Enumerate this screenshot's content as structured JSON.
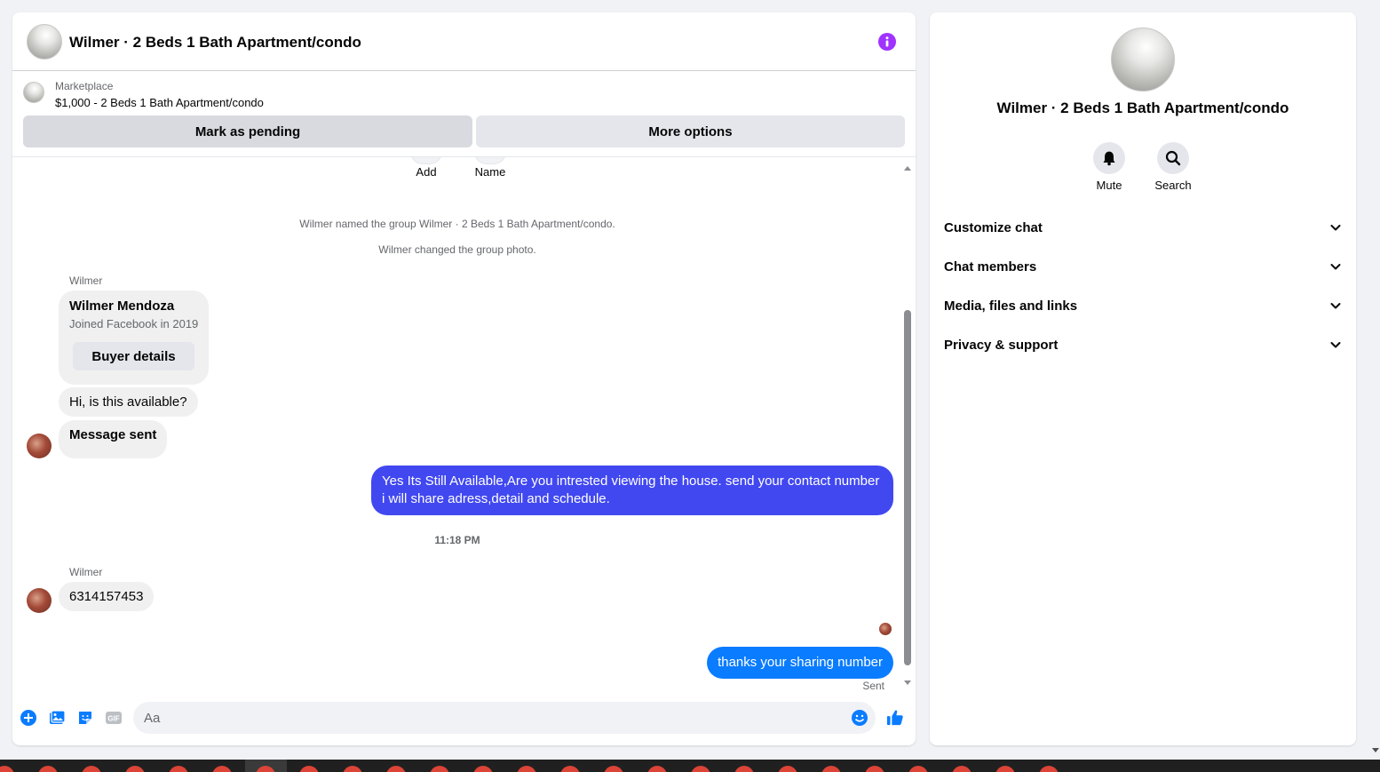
{
  "header": {
    "title": "Wilmer · 2 Beds 1 Bath Apartment/condo"
  },
  "marketplace": {
    "label": "Marketplace",
    "listing": "$1,000 - 2 Beds 1 Bath Apartment/condo",
    "mark_pending_label": "Mark as pending",
    "more_options_label": "More options"
  },
  "group_actions": {
    "add_label": "Add",
    "name_label": "Name"
  },
  "system_messages": [
    "Wilmer named the group Wilmer · 2 Beds 1 Bath Apartment/condo.",
    "Wilmer changed the group photo."
  ],
  "messages": {
    "sender_1": "Wilmer",
    "profile_card": {
      "name": "Wilmer Mendoza",
      "subtitle": "Joined Facebook in 2019",
      "button_label": "Buyer details"
    },
    "incoming_1": "Hi, is this available?",
    "incoming_2": "Message sent",
    "outgoing_1": "Yes Its Still Available,Are you intrested viewing the house. send your contact number i will share adress,detail and schedule.",
    "timestamp": "11:18 PM",
    "sender_2": "Wilmer",
    "incoming_3": "6314157453",
    "outgoing_2": "thanks your sharing number",
    "status": "Sent"
  },
  "composer": {
    "placeholder": "Aa"
  },
  "info_panel": {
    "title": "Wilmer · 2 Beds 1 Bath Apartment/condo",
    "mute_label": "Mute",
    "search_label": "Search",
    "sections": [
      "Customize chat",
      "Chat members",
      "Media, files and links",
      "Privacy & support"
    ]
  },
  "colors": {
    "accent_blue": "#0a7cff",
    "outgoing_purple": "#4148f0",
    "info_purple": "#a033ff",
    "taskbar_red": "#db4437"
  }
}
